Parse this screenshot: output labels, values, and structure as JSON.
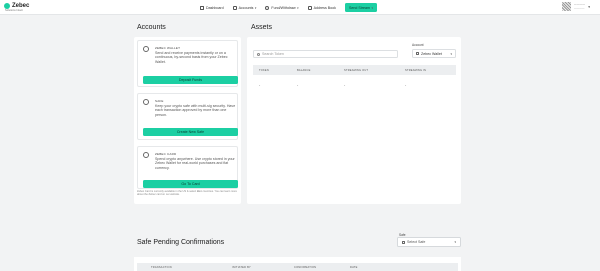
{
  "brand": {
    "name": "Zebec",
    "tagline": "Solutions Intact"
  },
  "nav": {
    "dashboard": "Dashboard",
    "accounts": "Accounts",
    "fund_withdraw": "Fund/Withdraw",
    "address_book": "Address Book",
    "send_button": "Send Stream"
  },
  "user": {
    "name": "————",
    "sub": "————"
  },
  "accounts": {
    "heading": "Accounts",
    "cards": [
      {
        "title": "ZEBEC WALLET",
        "desc": "Send and receive payments instantly or on a continuous, by-second basis from your Zebec Wallet.",
        "button": "Deposit Funds"
      },
      {
        "title": "SAFE",
        "desc": "Keep your crypto safe with multi-sig security. Have each transaction approved by more than one person.",
        "button": "Create New Safe"
      },
      {
        "title": "ZEBEC CARD",
        "desc": "Spend crypto anywhere. Use crypto stored in your Zebec Wallet for real-world purchases and fiat currency.",
        "button": "Go To Card"
      }
    ],
    "note": "Zebec Card is currently available in the US & select EEA countries. You can learn more about the Zebec card on our website."
  },
  "assets": {
    "heading": "Assets",
    "search_placeholder": "Search Token",
    "account_label": "Account",
    "account_value": "Zebec Wallet",
    "columns": [
      "TOKEN",
      "BALANCE",
      "STREAMING OUT",
      "STREAMING IN"
    ],
    "row": [
      "-",
      "-",
      "-",
      "-"
    ]
  },
  "pending": {
    "heading": "Safe Pending Confirmations",
    "safe_label": "Safe",
    "safe_placeholder": "Select Safe",
    "columns": [
      "TRANSACTION",
      "INITIATED BY",
      "CONFIRMATION",
      "DATE"
    ]
  },
  "colors": {
    "accent": "#1ccfa3",
    "background": "#f2f3f4"
  }
}
